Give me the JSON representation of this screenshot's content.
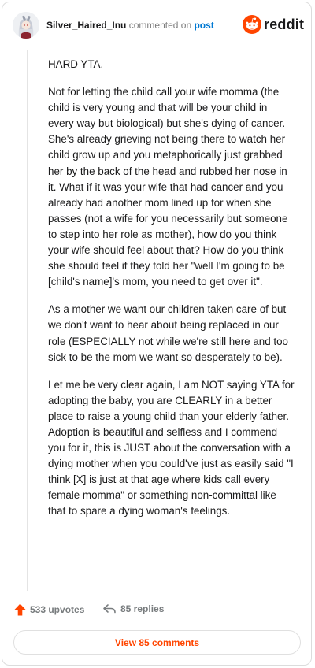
{
  "header": {
    "username": "Silver_Haired_Inu",
    "action_text": "commented on",
    "post_link": "post",
    "logo_text": "reddit"
  },
  "comment": {
    "paragraphs": [
      "HARD YTA.",
      "Not for letting the child call your wife momma (the child is very young and that will be your child in every way but biological) but she's dying of cancer. She's already grieving not being there to watch her child grow up and you metaphorically just grabbed her by the back of the head and rubbed her nose in it. What if it was your wife that had cancer and you already had another mom lined up for when she passes (not a wife for you necessarily but someone to step into her role as mother), how do you think your wife should feel about that? How do you think she should feel if they told her \"well I'm going to be [child's name]'s mom, you need to get over it\".",
      "As a mother we want our children taken care of but we don't want to hear about being replaced in our role (ESPECIALLY not while we're still here and too sick to be the mom we want so desperately to be).",
      "Let me be very clear again, I am NOT saying YTA for adopting the baby, you are CLEARLY in a better place to raise a young child than your elderly father. Adoption is beautiful and selfless and I commend you for it, this is JUST about the conversation with a dying mother when you could've just as easily said \"I think [X] is just at that age where kids call every female momma\" or something non-committal like that to spare a dying woman's feelings."
    ]
  },
  "actions": {
    "upvotes_label": "533 upvotes",
    "replies_label": "85 replies",
    "view_comments_label": "View 85 comments"
  },
  "colors": {
    "accent": "#ff4500",
    "link": "#0079d3"
  }
}
